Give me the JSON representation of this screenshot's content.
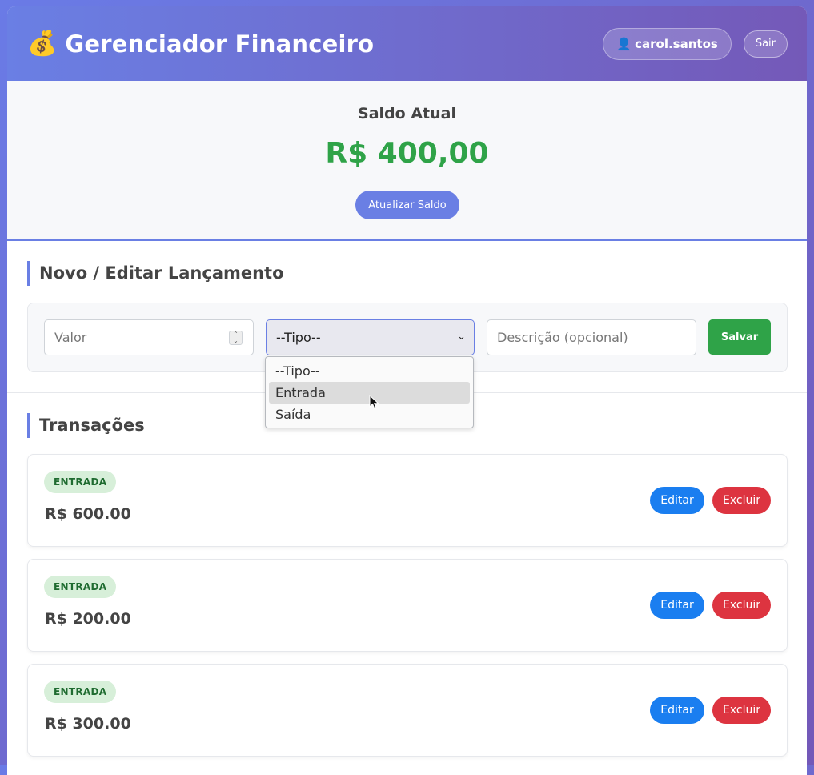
{
  "header": {
    "brand_icon": "💰",
    "title": "Gerenciador Financeiro",
    "user_icon": "👤",
    "username": "carol.santos",
    "logout_label": "Sair"
  },
  "balance": {
    "label": "Saldo Atual",
    "value": "R$ 400,00",
    "refresh_label": "Atualizar Saldo"
  },
  "form": {
    "title": "Novo / Editar Lançamento",
    "valor_placeholder": "Valor",
    "tipo_selected": "--Tipo--",
    "descricao_placeholder": "Descrição (opcional)",
    "save_label": "Salvar",
    "tipo_options": [
      "--Tipo--",
      "Entrada",
      "Saída"
    ],
    "hovered_option": "Entrada"
  },
  "transactions": {
    "title": "Transações",
    "items": [
      {
        "type": "ENTRADA",
        "amount": "R$ 600.00",
        "edit_label": "Editar",
        "delete_label": "Excluir"
      },
      {
        "type": "ENTRADA",
        "amount": "R$ 200.00",
        "edit_label": "Editar",
        "delete_label": "Excluir"
      },
      {
        "type": "ENTRADA",
        "amount": "R$ 300.00",
        "edit_label": "Editar",
        "delete_label": "Excluir"
      }
    ]
  },
  "colors": {
    "accent": "#6a7fe4",
    "success": "#2fa348",
    "edit": "#1a7ef0",
    "danger": "#dd3440"
  }
}
